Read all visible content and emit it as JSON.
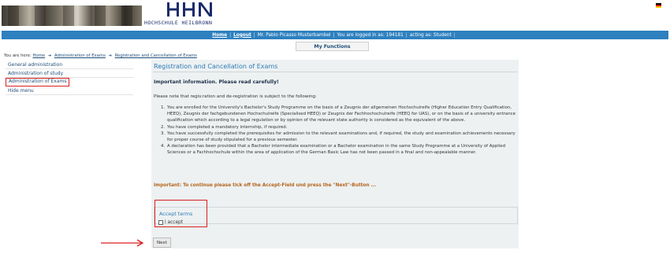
{
  "header": {
    "logo_text": "HOCHSCHULE HEILBRONN",
    "logo_letters": "HHN",
    "brand_color": "#1b2b6b",
    "flag": "german-flag-icon"
  },
  "topbar": {
    "home": "Home",
    "logout": "Logout",
    "user_text": "Mr. Pablo Picasso Musterbambel",
    "login_text": "You are logged in as: 194181",
    "role_text": "acting as: Student",
    "sep": "|",
    "color": "#2e80bf"
  },
  "my_functions": "My Functions",
  "breadcrumb": {
    "prefix": "You are here:",
    "home": "Home",
    "level1": "Administration of Exams",
    "level2": "Registration and Cancellation of Exams"
  },
  "sidebar": {
    "items": [
      {
        "label": "General administration"
      },
      {
        "label": "Administration of study"
      },
      {
        "label": "Administration of Exams"
      },
      {
        "label": "Hide menu"
      }
    ]
  },
  "main": {
    "title": "Registration and Cancellation of Exams",
    "important": "Important information. Please read carefully!",
    "intro": "Please note that regis:ration and de-registration is subject to the following:",
    "list": [
      {
        "num": "1.",
        "text": "You are enrolled for the University's Bachelor's Study Programme on the basis of a Zeugnis der allgemeinen Hochschulreife (Higher Education Entry Qualification, HEEQ), Zeugnis der fachgebundenen Hochschulreife (Specialised HEEQ) or Zeugnis der Fachhochschulreife (HEEQ for UAS), or on the basis of a university entrance qualification which according to a legal regulation or by opinion of the relevant state authority is considered as the equivalent of the above."
      },
      {
        "num": "2.",
        "text": "You have completed a mandatory internship, if required."
      },
      {
        "num": "3.",
        "text": "You have successfully completed the prerequisites for admission to the relevant examinations and, if required, the study and examination achievements necessary for proper course of study stipulated for a previous semester."
      },
      {
        "num": "4.",
        "text": "A declaration has been provided that a Bachelor intermediate examination or a Bachelor examination in the same Study Programme at a University of Applied Sciences or a Fachhochschule within the area of application of the German Basic Law has not been passed in a final and non-appealable manner."
      }
    ],
    "notice": "Important: To continue please tick off the Accept-Field und press the \"Next\"-Button ...",
    "accept_legend": "Accept terms",
    "accept_label": "I accept",
    "accept_checked": false,
    "next_label": "Next"
  }
}
